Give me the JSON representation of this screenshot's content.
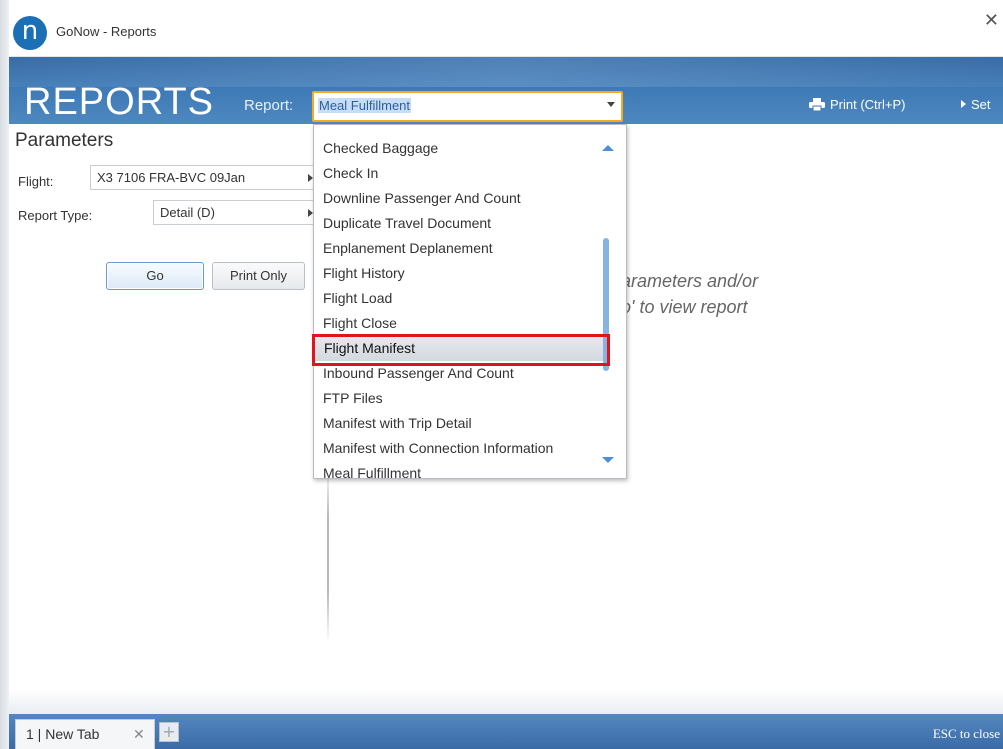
{
  "window": {
    "logo_letter": "n",
    "title": "GoNow - Reports",
    "close_symbol": "✕"
  },
  "header": {
    "brand": "REPORTS",
    "report_label": "Report:",
    "report_selected": "Meal Fulfillment",
    "print_label": "Print (Ctrl+P)",
    "settings_label": "Set"
  },
  "parameters": {
    "title": "Parameters",
    "flight_label": "Flight:",
    "flight_value": "X3 7106 FRA-BVC 09Jan",
    "report_type_label": "Report Type:",
    "report_type_value": "Detail (D)",
    "go_label": "Go",
    "print_only_label": "Print Only"
  },
  "hint": {
    "line1": "arameters and/or",
    "line2": "o' to view report"
  },
  "dropdown": {
    "items": [
      "Checked Baggage",
      "Check In",
      "Downline Passenger And Count",
      "Duplicate Travel Document",
      "Enplanement Deplanement",
      "Flight History",
      "Flight Load",
      "Flight Close",
      "Flight Manifest",
      "Inbound Passenger And Count",
      "FTP Files",
      "Manifest with Trip Detail",
      "Manifest with Connection Information",
      "Meal Fulfillment"
    ],
    "highlighted": "Flight Manifest"
  },
  "tabs": {
    "items": [
      {
        "label": "1 | New Tab",
        "close": "✕"
      }
    ],
    "add_symbol": "+"
  },
  "footer": {
    "esc_hint": "ESC to close"
  },
  "colors": {
    "header_blue": "#3d79b5",
    "select_border": "#f0ad1e",
    "highlight_red": "#e0141c",
    "scroll_blue": "#86b3e2"
  }
}
